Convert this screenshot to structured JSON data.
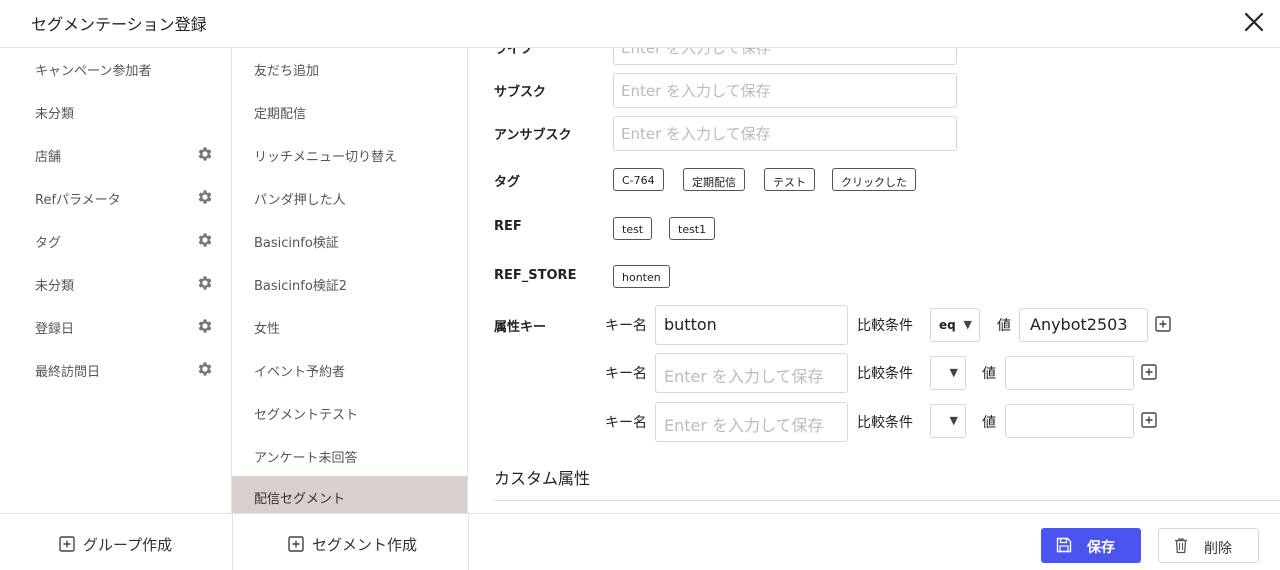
{
  "modal": {
    "title": "セグメンテーション登録"
  },
  "groups": [
    {
      "label": "キャンペーン参加者",
      "gear": false
    },
    {
      "label": "未分類",
      "gear": false
    },
    {
      "label": "店舗",
      "gear": true
    },
    {
      "label": "Refパラメータ",
      "gear": true
    },
    {
      "label": "タグ",
      "gear": true
    },
    {
      "label": "未分類",
      "gear": true
    },
    {
      "label": "登録日",
      "gear": true
    },
    {
      "label": "最終訪問日",
      "gear": true
    }
  ],
  "segments": [
    {
      "label": "友だち追加"
    },
    {
      "label": "定期配信"
    },
    {
      "label": "リッチメニュー切り替え"
    },
    {
      "label": "パンダ押した人"
    },
    {
      "label": "Basicinfo検証"
    },
    {
      "label": "Basicinfo検証2"
    },
    {
      "label": "女性"
    },
    {
      "label": "イベント予約者"
    },
    {
      "label": "セグメントテスト"
    },
    {
      "label": "アンケート未回答"
    },
    {
      "label": "配信セグメント",
      "active": true
    }
  ],
  "form": {
    "top_partial_label": "ライフ",
    "placeholder": "Enter を入力して保存",
    "subscribe_label": "サブスク",
    "unsubscribe_label": "アンサブスク",
    "tag_label": "タグ",
    "tags": [
      "C-764",
      "定期配信",
      "テスト",
      "クリックした"
    ],
    "ref_label": "REF",
    "refs": [
      "test",
      "test1"
    ],
    "ref_store_label": "REF_STORE",
    "ref_stores": [
      "honten"
    ],
    "attr_label": "属性キー",
    "key_name_label": "キー名",
    "compare_label": "比較条件",
    "value_label": "値",
    "attr_rows": [
      {
        "key": "button",
        "op": "eq",
        "value": "Anybot2503"
      },
      {
        "key": "",
        "op": "",
        "value": ""
      },
      {
        "key": "",
        "op": "",
        "value": ""
      }
    ],
    "custom_attr_label": "カスタム属性"
  },
  "footer": {
    "create_group": "グループ作成",
    "create_segment": "セグメント作成",
    "save": "保存",
    "delete": "削除"
  },
  "colors": {
    "primary": "#4a55f0",
    "active_item": "#d8d0cc"
  }
}
